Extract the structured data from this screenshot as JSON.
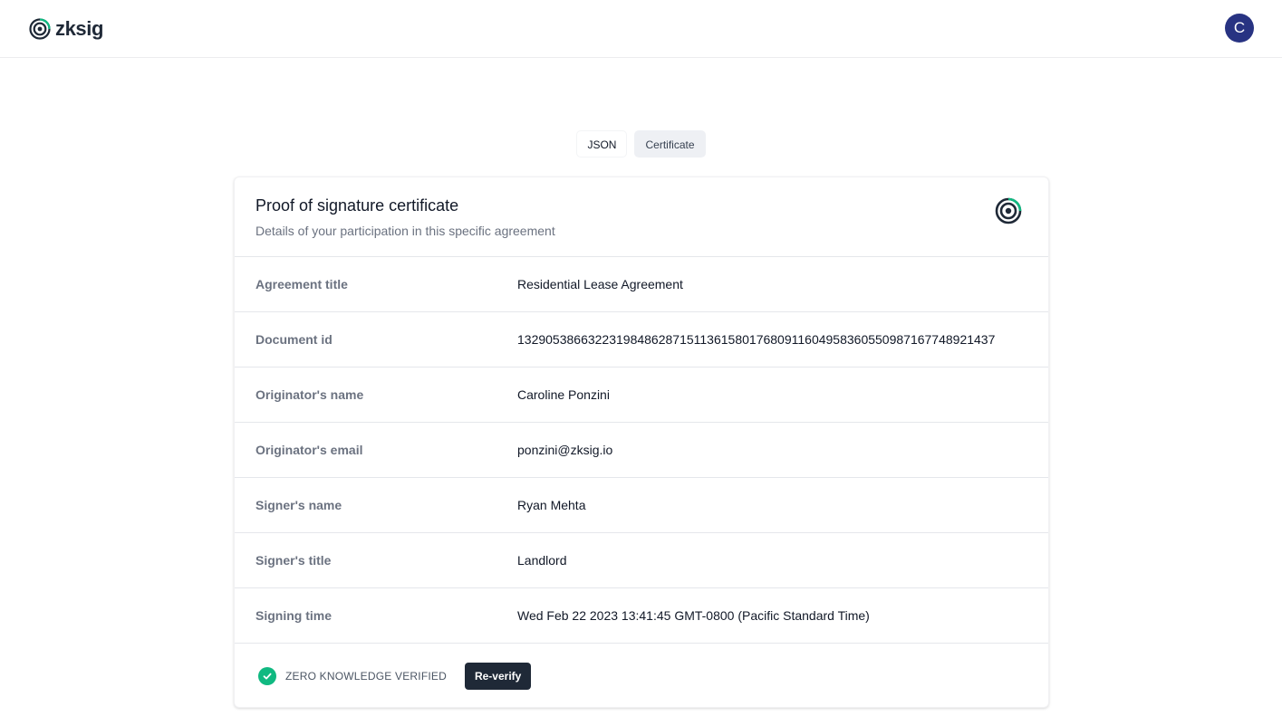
{
  "app": {
    "brand": "zksig",
    "user_initial": "C",
    "logo_icon": "zksig-spiral-logo-icon",
    "accent_color": "#10b981",
    "avatar_color": "#283382"
  },
  "tabs": [
    {
      "label": "JSON",
      "active": false
    },
    {
      "label": "Certificate",
      "active": true
    }
  ],
  "certificate": {
    "title": "Proof of signature certificate",
    "subtitle": "Details of your participation in this specific agreement",
    "rows": [
      {
        "label": "Agreement title",
        "value": "Residential Lease Agreement"
      },
      {
        "label": "Document id",
        "value": "13290538663223198486287151136158017680911604958360550987167748921437"
      },
      {
        "label": "Originator's name",
        "value": "Caroline Ponzini"
      },
      {
        "label": "Originator's email",
        "value": "ponzini@zksig.io"
      },
      {
        "label": "Signer's name",
        "value": "Ryan Mehta"
      },
      {
        "label": "Signer's title",
        "value": "Landlord"
      },
      {
        "label": "Signing time",
        "value": "Wed Feb 22 2023 13:41:45 GMT-0800 (Pacific Standard Time)"
      }
    ],
    "verified_text": "ZERO KNOWLEDGE VERIFIED",
    "verified_icon": "check-circle-icon",
    "reverify_label": "Re-verify"
  }
}
